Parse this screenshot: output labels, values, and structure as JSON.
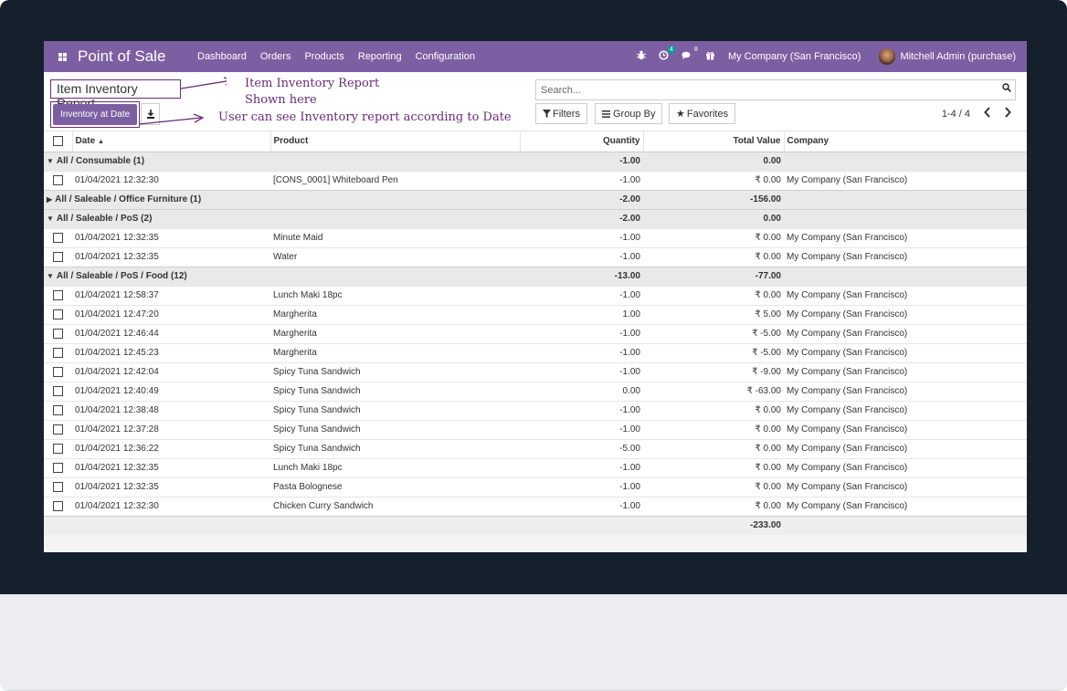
{
  "navbar": {
    "app_name": "Point of Sale",
    "menu": [
      "Dashboard",
      "Orders",
      "Products",
      "Reporting",
      "Configuration"
    ],
    "activity_count": "4",
    "message_count": "8",
    "company": "My Company (San Francisco)",
    "user": "Mitchell Admin (purchase)"
  },
  "control_panel": {
    "title": "Item Inventory Report",
    "inventory_at_date_label": "Inventory at Date",
    "search_placeholder": "Search...",
    "filters_label": "Filters",
    "group_by_label": "Group By",
    "favorites_label": "Favorites",
    "pager": "1-4 / 4"
  },
  "annotations": {
    "line1": "Item Inventory Report",
    "line2": "Shown here",
    "line3": "User can see Inventory report according to Date"
  },
  "table": {
    "headers": {
      "date": "Date",
      "product": "Product",
      "quantity": "Quantity",
      "total_value": "Total Value",
      "company": "Company"
    },
    "groups": [
      {
        "label": "All / Consumable (1)",
        "quantity": "-1.00",
        "value": "0.00",
        "open": true,
        "rows": [
          {
            "date": "01/04/2021 12:32:30",
            "product": "[CONS_0001] Whiteboard Pen",
            "quantity": "-1.00",
            "value": "₹ 0.00",
            "company": "My Company (San Francisco)"
          }
        ]
      },
      {
        "label": "All / Saleable / Office Furniture (1)",
        "quantity": "-2.00",
        "value": "-156.00",
        "open": false,
        "rows": []
      },
      {
        "label": "All / Saleable / PoS (2)",
        "quantity": "-2.00",
        "value": "0.00",
        "open": true,
        "rows": [
          {
            "date": "01/04/2021 12:32:35",
            "product": "Minute Maid",
            "quantity": "-1.00",
            "value": "₹ 0.00",
            "company": "My Company (San Francisco)"
          },
          {
            "date": "01/04/2021 12:32:35",
            "product": "Water",
            "quantity": "-1.00",
            "value": "₹ 0.00",
            "company": "My Company (San Francisco)"
          }
        ]
      },
      {
        "label": "All / Saleable / PoS / Food (12)",
        "quantity": "-13.00",
        "value": "-77.00",
        "open": true,
        "rows": [
          {
            "date": "01/04/2021 12:58:37",
            "product": "Lunch Maki 18pc",
            "quantity": "-1.00",
            "value": "₹ 0.00",
            "company": "My Company (San Francisco)"
          },
          {
            "date": "01/04/2021 12:47:20",
            "product": "Margherita",
            "quantity": "1.00",
            "value": "₹ 5.00",
            "company": "My Company (San Francisco)"
          },
          {
            "date": "01/04/2021 12:46:44",
            "product": "Margherita",
            "quantity": "-1.00",
            "value": "₹ -5.00",
            "company": "My Company (San Francisco)"
          },
          {
            "date": "01/04/2021 12:45:23",
            "product": "Margherita",
            "quantity": "-1.00",
            "value": "₹ -5.00",
            "company": "My Company (San Francisco)"
          },
          {
            "date": "01/04/2021 12:42:04",
            "product": "Spicy Tuna Sandwich",
            "quantity": "-1.00",
            "value": "₹ -9.00",
            "company": "My Company (San Francisco)"
          },
          {
            "date": "01/04/2021 12:40:49",
            "product": "Spicy Tuna Sandwich",
            "quantity": "0.00",
            "value": "₹ -63.00",
            "company": "My Company (San Francisco)"
          },
          {
            "date": "01/04/2021 12:38:48",
            "product": "Spicy Tuna Sandwich",
            "quantity": "-1.00",
            "value": "₹ 0.00",
            "company": "My Company (San Francisco)"
          },
          {
            "date": "01/04/2021 12:37:28",
            "product": "Spicy Tuna Sandwich",
            "quantity": "-1.00",
            "value": "₹ 0.00",
            "company": "My Company (San Francisco)"
          },
          {
            "date": "01/04/2021 12:36:22",
            "product": "Spicy Tuna Sandwich",
            "quantity": "-5.00",
            "value": "₹ 0.00",
            "company": "My Company (San Francisco)"
          },
          {
            "date": "01/04/2021 12:32:35",
            "product": "Lunch Maki 18pc",
            "quantity": "-1.00",
            "value": "₹ 0.00",
            "company": "My Company (San Francisco)"
          },
          {
            "date": "01/04/2021 12:32:35",
            "product": "Pasta Bolognese",
            "quantity": "-1.00",
            "value": "₹ 0.00",
            "company": "My Company (San Francisco)"
          },
          {
            "date": "01/04/2021 12:32:30",
            "product": "Chicken Curry Sandwich",
            "quantity": "-1.00",
            "value": "₹ 0.00",
            "company": "My Company (San Francisco)"
          }
        ]
      }
    ],
    "total_value": "-233.00"
  },
  "colors": {
    "brand": "#7c5fa2",
    "annotation": "#6b2a7a"
  }
}
